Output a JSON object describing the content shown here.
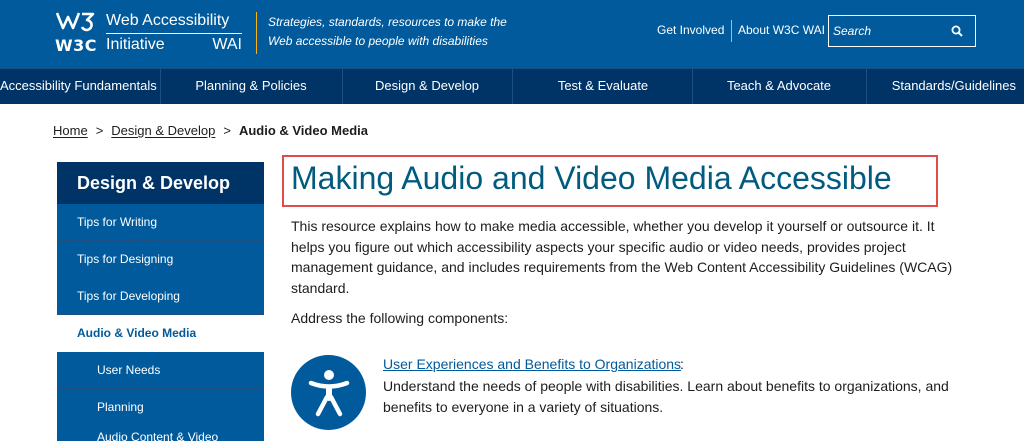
{
  "header": {
    "logo_text": "W3C",
    "wai_line1": "Web Accessibility",
    "wai_line2a": "Initiative",
    "wai_line2b": "WAI",
    "tagline": "Strategies, standards, resources to make the Web accessible to people with disabilities",
    "links": [
      "Get Involved",
      "About W3C WAI"
    ],
    "search_placeholder": "Search"
  },
  "nav": {
    "items": [
      "Accessibility Fundamentals",
      "Planning & Policies",
      "Design & Develop",
      "Test & Evaluate",
      "Teach & Advocate",
      "Standards/Guidelines"
    ]
  },
  "breadcrumb": {
    "items": [
      "Home",
      "Design & Develop"
    ],
    "separator": ">",
    "current": "Audio & Video Media"
  },
  "sidebar": {
    "title": "Design & Develop",
    "items": [
      {
        "label": "Tips for Writing"
      },
      {
        "label": "Tips for Designing"
      },
      {
        "label": "Tips for Developing"
      },
      {
        "label": "Audio & Video Media",
        "active": true
      },
      {
        "label": "User Needs"
      },
      {
        "label": "Planning"
      },
      {
        "label": "Audio Content & Video"
      }
    ]
  },
  "content": {
    "title": "Making Audio and Video Media Accessible",
    "intro": "This resource explains how to make media accessible, whether you develop it yourself or outsource it. It helps you figure out which accessibility aspects your specific audio or video needs, provides project management guidance, and includes requirements from the Web Content Accessibility Guidelines (WCAG) standard.",
    "address": "Address the following components:",
    "component_link": "User Experiences and Benefits to Organizations",
    "component_colon": ":",
    "component_desc": "Understand the needs of people with disabilities. Learn about benefits to organizations, and benefits to everyone in a variety of situations."
  },
  "colors": {
    "brand_blue": "#005a9c",
    "nav_dark": "#003366",
    "accent_gold": "#fcb415",
    "highlight_red": "#e04b4b"
  }
}
